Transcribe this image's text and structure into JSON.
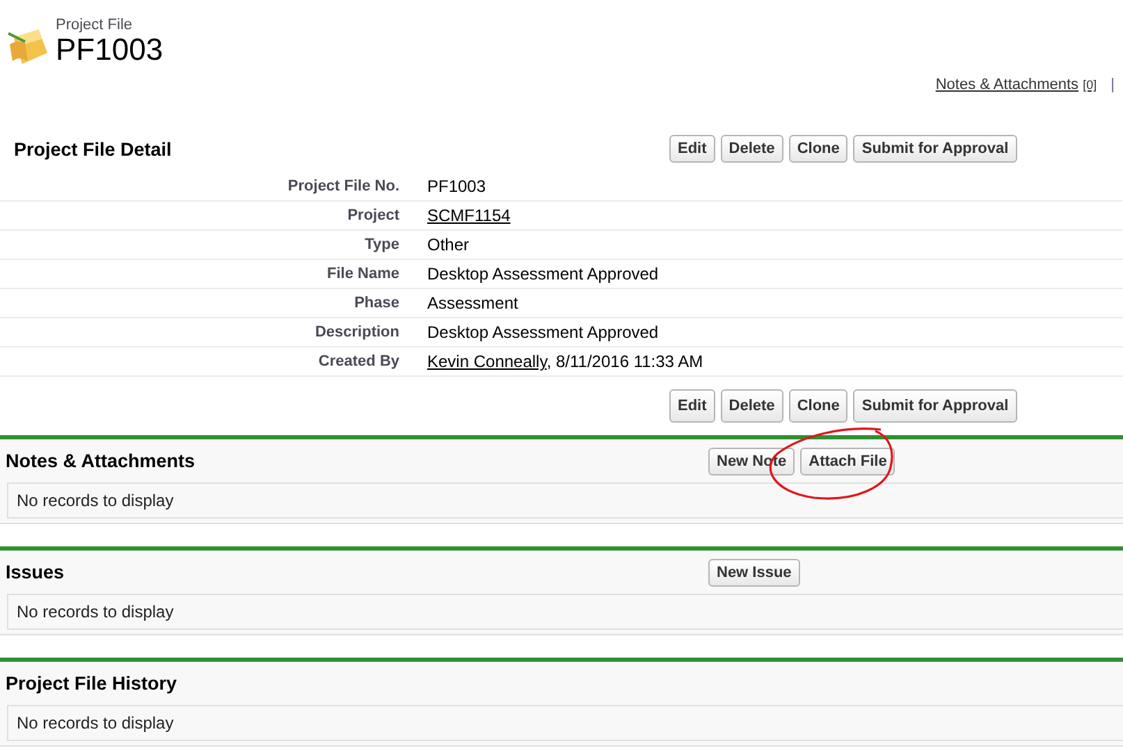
{
  "header": {
    "object_type": "Project File",
    "record_name": "PF1003"
  },
  "top_links": [
    {
      "label": "Notes & Attachments",
      "count": "[0]"
    }
  ],
  "top_links_separator": "|",
  "detail": {
    "title": "Project File Detail",
    "buttons": [
      "Edit",
      "Delete",
      "Clone",
      "Submit for Approval"
    ],
    "fields": [
      {
        "label": "Project File No.",
        "parts": [
          {
            "text": "PF1003",
            "link": false
          }
        ]
      },
      {
        "label": "Project",
        "parts": [
          {
            "text": "SCMF1154",
            "link": true
          }
        ]
      },
      {
        "label": "Type",
        "parts": [
          {
            "text": "Other",
            "link": false
          }
        ]
      },
      {
        "label": "File Name",
        "parts": [
          {
            "text": "Desktop Assessment Approved",
            "link": false
          }
        ]
      },
      {
        "label": "Phase",
        "parts": [
          {
            "text": "Assessment",
            "link": false
          }
        ]
      },
      {
        "label": "Description",
        "parts": [
          {
            "text": "Desktop Assessment Approved",
            "link": false
          }
        ]
      },
      {
        "label": "Created By",
        "parts": [
          {
            "text": "Kevin Conneally",
            "link": true
          },
          {
            "text": ", 8/11/2016 11:33 AM",
            "link": false
          }
        ]
      }
    ],
    "bottom_buttons": [
      "Edit",
      "Delete",
      "Clone",
      "Submit for Approval"
    ]
  },
  "related_lists": [
    {
      "title": "Notes & Attachments",
      "buttons": [
        {
          "label": "New Note",
          "circled": false
        },
        {
          "label": "Attach File",
          "circled": true
        }
      ],
      "empty_text": "No records to display"
    },
    {
      "title": "Issues",
      "buttons": [
        {
          "label": "New Issue",
          "circled": false
        }
      ],
      "empty_text": "No records to display"
    },
    {
      "title": "Project File History",
      "empty_text": "No records to display"
    }
  ]
}
